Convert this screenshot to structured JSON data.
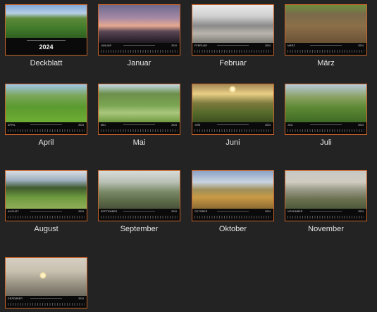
{
  "year": "2024",
  "accent_color": "#c8642a",
  "background_color": "#232323",
  "pages": [
    {
      "label": "Deckblatt",
      "strip_month": "",
      "cover": true
    },
    {
      "label": "Januar",
      "strip_month": "JANUAR"
    },
    {
      "label": "Februar",
      "strip_month": "FEBRUAR"
    },
    {
      "label": "März",
      "strip_month": "MÄRZ"
    },
    {
      "label": "April",
      "strip_month": "APRIL"
    },
    {
      "label": "Mai",
      "strip_month": "MAI"
    },
    {
      "label": "Juni",
      "strip_month": "JUNI"
    },
    {
      "label": "Juli",
      "strip_month": "JULI"
    },
    {
      "label": "August",
      "strip_month": "AUGUST"
    },
    {
      "label": "September",
      "strip_month": "SEPTEMBER"
    },
    {
      "label": "Oktober",
      "strip_month": "OKTOBER"
    },
    {
      "label": "November",
      "strip_month": "NOVEMBER"
    },
    {
      "label": "",
      "strip_month": "DEZEMBER"
    }
  ]
}
